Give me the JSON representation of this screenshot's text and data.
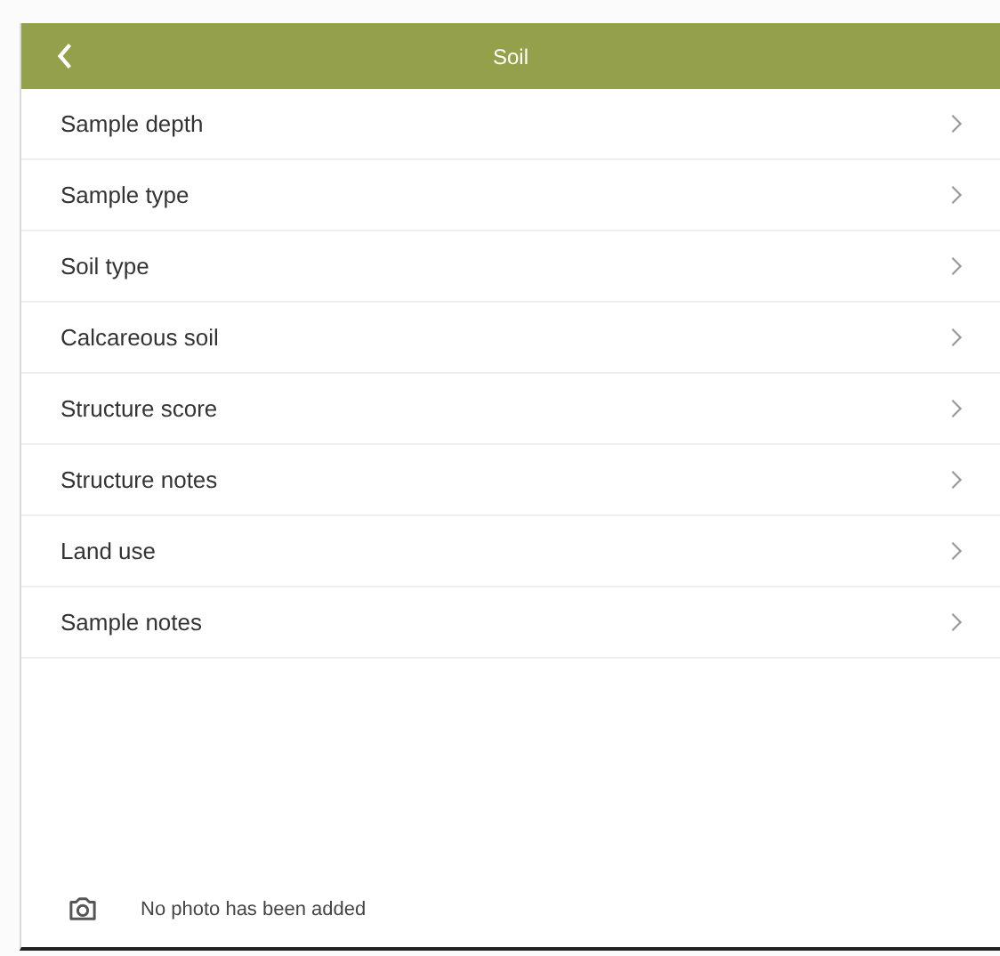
{
  "header": {
    "title": "Soil"
  },
  "items": [
    {
      "label": "Sample depth"
    },
    {
      "label": "Sample type"
    },
    {
      "label": "Soil type"
    },
    {
      "label": "Calcareous soil"
    },
    {
      "label": "Structure score"
    },
    {
      "label": "Structure notes"
    },
    {
      "label": "Land use"
    },
    {
      "label": "Sample notes"
    }
  ],
  "photo": {
    "message": "No photo has been added"
  }
}
